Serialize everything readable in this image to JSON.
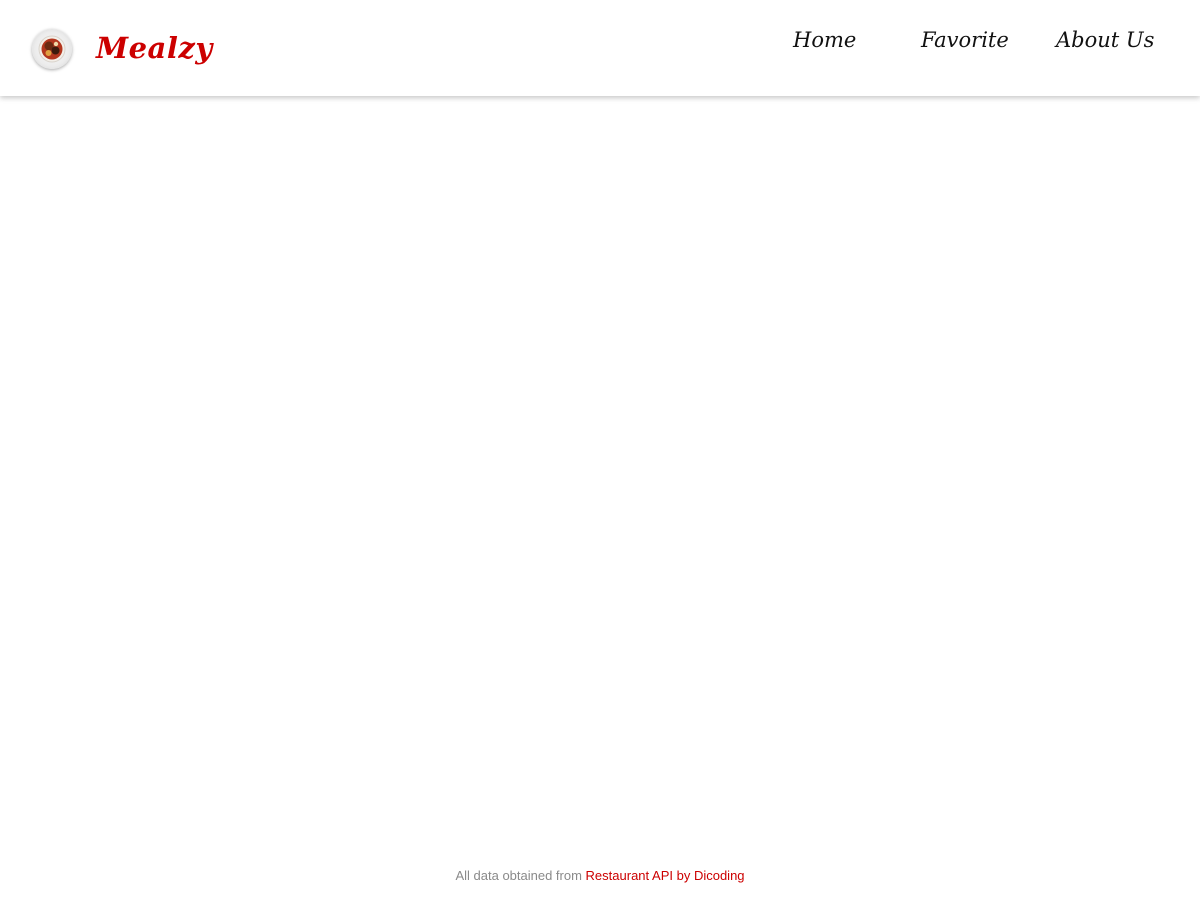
{
  "header": {
    "brand": "Mealzy",
    "logo_icon": "food-plate-icon",
    "nav": [
      {
        "label": "Home"
      },
      {
        "label": "Favorite"
      },
      {
        "label": "About Us"
      }
    ]
  },
  "main": {},
  "footer": {
    "prefix": "All data obtained from ",
    "link_label": "Restaurant API by Dicoding"
  },
  "colors": {
    "brand": "#cc0000",
    "nav_text": "#111111",
    "footer_text": "#8a8a8a",
    "background": "#ffffff"
  }
}
